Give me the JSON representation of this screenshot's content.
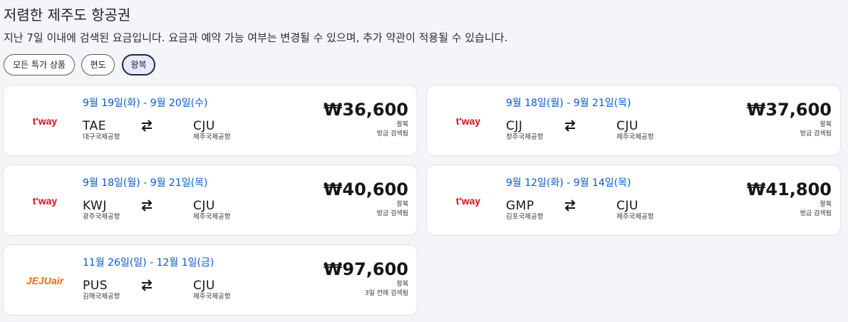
{
  "header": {
    "title": "저렴한 제주도 항공권",
    "subtitle": "지난 7일 이내에 검색된 요금입니다. 요금과 예약 가능 여부는 변경될 수 있으며, 추가 약관이 적용될 수 있습니다."
  },
  "filters": [
    {
      "label": "모든 특가 상품",
      "selected": false
    },
    {
      "label": "편도",
      "selected": false
    },
    {
      "label": "왕복",
      "selected": true
    }
  ],
  "colors": {
    "date_blue": "#0a58cd",
    "tway_red": "#d4111f",
    "jeju_orange": "#ef6a10",
    "selected_chip_bg": "#e4ebff",
    "selected_chip_border": "#1c2a48"
  },
  "deals": [
    {
      "airline": "t'way",
      "logo_icon": "tway-logo",
      "dates": "9월 19일(화) - 9월 20일(수)",
      "origin_code": "TAE",
      "origin_name": "대구국제공항",
      "dest_code": "CJU",
      "dest_name": "제주국제공항",
      "price": "₩36,600",
      "trip_type": "왕복",
      "searched": "방금 검색됨"
    },
    {
      "airline": "t'way",
      "logo_icon": "tway-logo",
      "dates": "9월 18일(월) - 9월 21일(목)",
      "origin_code": "CJJ",
      "origin_name": "청주국제공항",
      "dest_code": "CJU",
      "dest_name": "제주국제공항",
      "price": "₩37,600",
      "trip_type": "왕복",
      "searched": "방금 검색됨"
    },
    {
      "airline": "t'way",
      "logo_icon": "tway-logo",
      "dates": "9월 18일(월) - 9월 21일(목)",
      "origin_code": "KWJ",
      "origin_name": "광주국제공항",
      "dest_code": "CJU",
      "dest_name": "제주국제공항",
      "price": "₩40,600",
      "trip_type": "왕복",
      "searched": "방금 검색됨"
    },
    {
      "airline": "t'way",
      "logo_icon": "tway-logo",
      "dates": "9월 12일(화) - 9월 14일(목)",
      "origin_code": "GMP",
      "origin_name": "김포국제공항",
      "dest_code": "CJU",
      "dest_name": "제주국제공항",
      "price": "₩41,800",
      "trip_type": "왕복",
      "searched": "방금 검색됨"
    },
    {
      "airline": "JEJUair",
      "logo_icon": "jejuair-logo",
      "dates": "11월 26일(일) - 12월 1일(금)",
      "origin_code": "PUS",
      "origin_name": "김해국제공항",
      "dest_code": "CJU",
      "dest_name": "제주국제공항",
      "price": "₩97,600",
      "trip_type": "왕복",
      "searched": "3일 전에 검색됨"
    }
  ]
}
